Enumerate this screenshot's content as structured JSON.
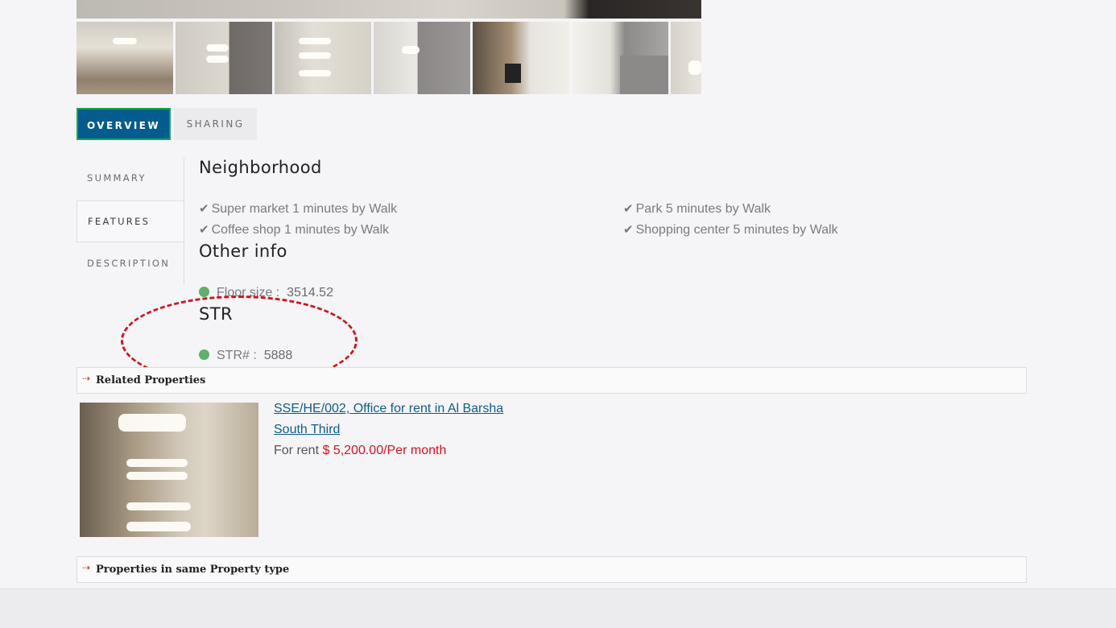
{
  "gallery": {
    "thumbnails": [
      "thumb-1",
      "thumb-2",
      "thumb-3",
      "thumb-4",
      "thumb-5",
      "thumb-6",
      "thumb-7"
    ]
  },
  "tabs": {
    "overview": "OVERVIEW",
    "sharing": "SHARING"
  },
  "side_tabs": {
    "summary": "SUMMARY",
    "features": "FEATURES",
    "description": "DESCRIPTION"
  },
  "neighborhood": {
    "title": "Neighborhood",
    "items": [
      "Super market 1 minutes by Walk",
      "Park 5 minutes by Walk",
      "Coffee shop 1 minutes by Walk",
      "Shopping center 5 minutes by Walk"
    ],
    "icon": "check-icon"
  },
  "other_info": {
    "title": "Other info",
    "label": "Floor size :",
    "value": "3514.52"
  },
  "str": {
    "title": "STR",
    "label": "STR# :",
    "value": "5888"
  },
  "related": {
    "title": "Related Properties",
    "link_line1": "SSE/HE/002, Office for rent in Al Barsha",
    "link_line2": "South Third",
    "status": "For rent",
    "price": "$ 5,200.00/Per month"
  },
  "same_type": {
    "title": "Properties in same Property type"
  },
  "colors": {
    "accent": "#045c8e",
    "highlight": "#17a84d",
    "price": "#d3141c",
    "dot": "#5fb06a",
    "annotation": "#d0151c"
  }
}
